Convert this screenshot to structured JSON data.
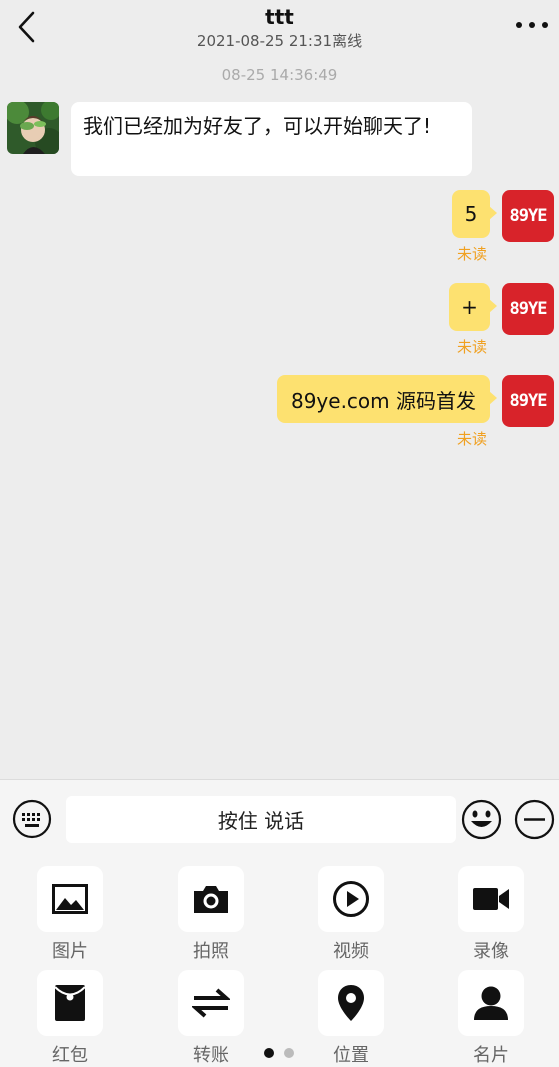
{
  "header": {
    "title": "ttt",
    "subtitle": "2021-08-25 21:31离线"
  },
  "chat": {
    "timestamp": "08-25 14:36:49",
    "friend_message": "我们已经加为好友了，可以开始聊天了!",
    "self_avatar_text": "89YE",
    "messages": [
      {
        "text": "5",
        "status": "未读"
      },
      {
        "text": "+",
        "status": "未读"
      },
      {
        "text": "89ye.com 源码首发",
        "status": "未读"
      }
    ]
  },
  "input": {
    "voice_label": "按住 说话"
  },
  "tools": [
    {
      "label": "图片",
      "icon": "image-icon"
    },
    {
      "label": "拍照",
      "icon": "camera-icon"
    },
    {
      "label": "视频",
      "icon": "video-play-icon"
    },
    {
      "label": "录像",
      "icon": "video-camera-icon"
    },
    {
      "label": "红包",
      "icon": "red-envelope-icon"
    },
    {
      "label": "转账",
      "icon": "transfer-icon"
    },
    {
      "label": "位置",
      "icon": "location-icon"
    },
    {
      "label": "名片",
      "icon": "contact-card-icon"
    }
  ],
  "pager": {
    "pages": 2,
    "current": 1
  },
  "colors": {
    "bubble_self": "#fde170",
    "unread": "#f0a020",
    "avatar_self": "#d8232a"
  }
}
